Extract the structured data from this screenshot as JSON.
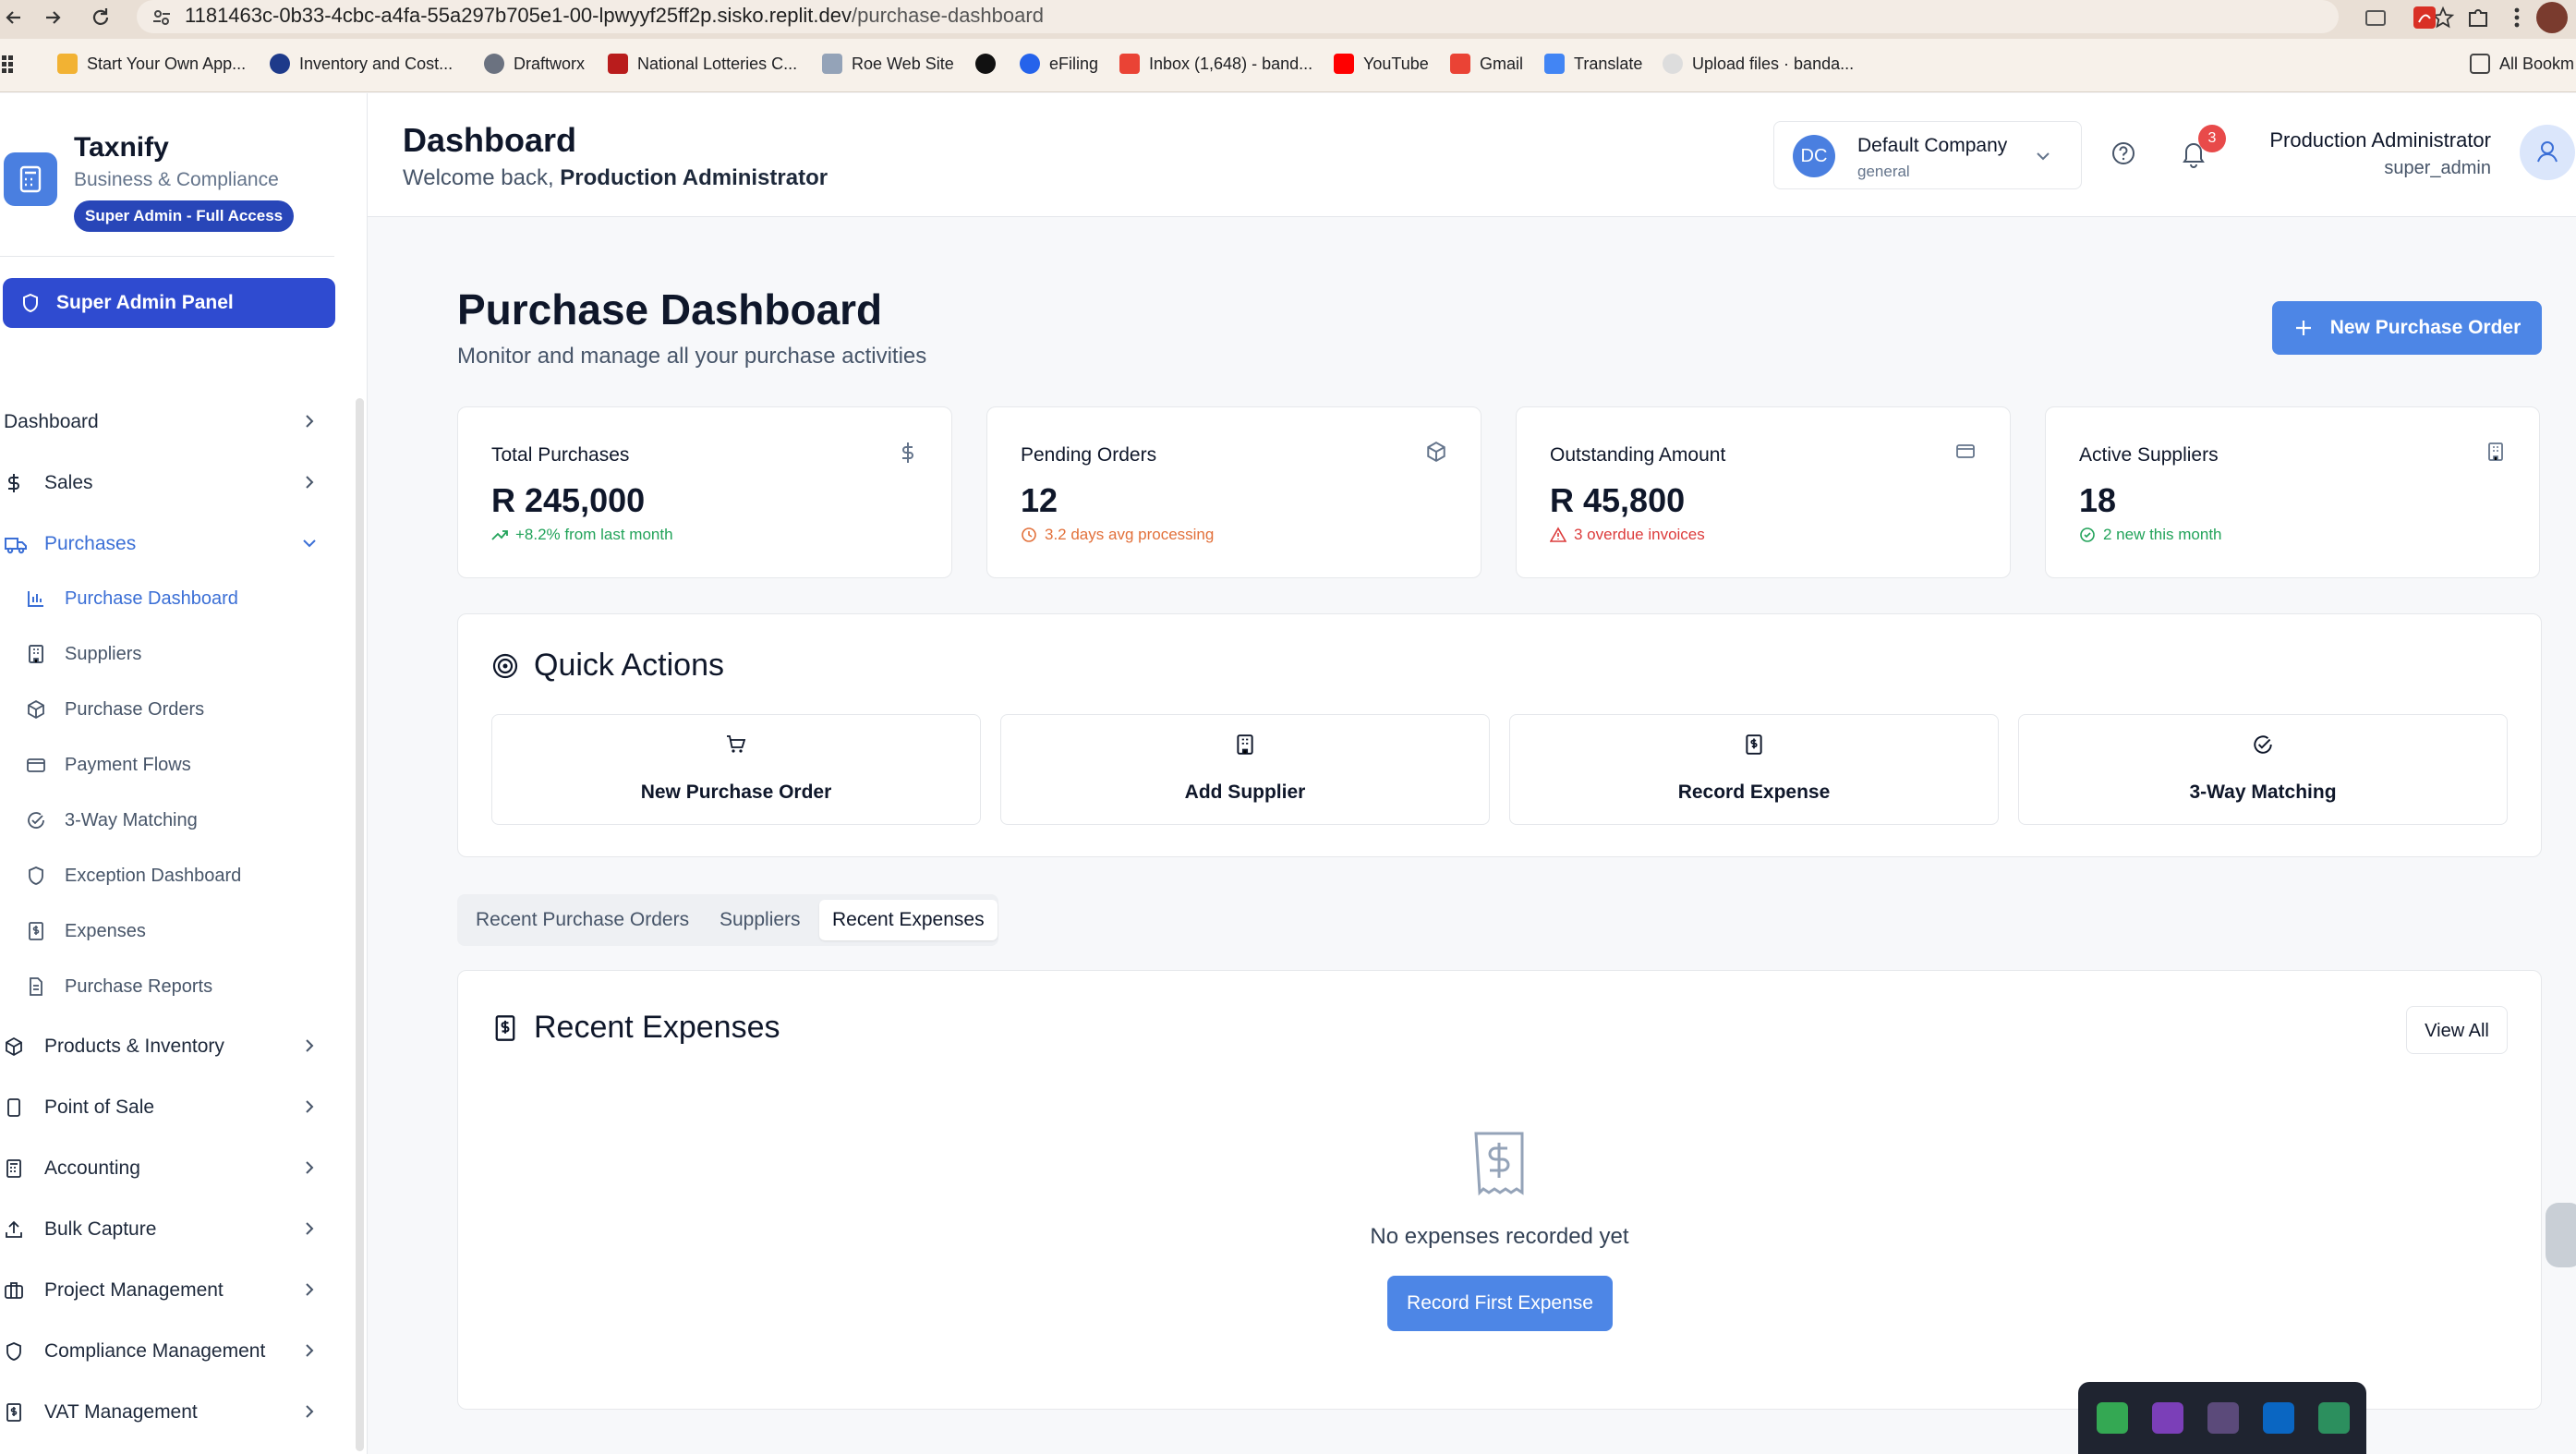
{
  "browser": {
    "url_host": "1181463c-0b33-4cbc-a4fa-55a297b705e1-00-lpwyyf25ff2p.sisko.replit.dev",
    "url_path": "/purchase-dashboard",
    "bookmarks": [
      "Start Your Own App...",
      "Inventory and Cost...",
      "Draftworx",
      "National Lotteries C...",
      "Roe Web Site",
      "",
      "eFiling",
      "Inbox (1,648) - band...",
      "YouTube",
      "Gmail",
      "Translate",
      "Upload files · banda...",
      "All Bookm"
    ]
  },
  "brand": {
    "name": "Taxnify",
    "subtitle": "Business & Compliance",
    "badge": "Super Admin - Full Access"
  },
  "sidebar": {
    "admin_panel": "Super Admin Panel",
    "items": [
      {
        "label": "Dashboard",
        "icon": "none"
      },
      {
        "label": "Sales",
        "icon": "dollar-icon"
      },
      {
        "label": "Purchases",
        "icon": "truck-icon"
      },
      {
        "label": "Products & Inventory",
        "icon": "package-icon"
      },
      {
        "label": "Point of Sale",
        "icon": "tablet-icon"
      },
      {
        "label": "Accounting",
        "icon": "calculator-icon"
      },
      {
        "label": "Bulk Capture",
        "icon": "upload-icon"
      },
      {
        "label": "Project Management",
        "icon": "briefcase-icon"
      },
      {
        "label": "Compliance Management",
        "icon": "shield-icon"
      },
      {
        "label": "VAT Management",
        "icon": "receipt-icon"
      }
    ],
    "purchases_sub": [
      {
        "label": "Purchase Dashboard",
        "icon": "bar-chart-icon"
      },
      {
        "label": "Suppliers",
        "icon": "building-icon"
      },
      {
        "label": "Purchase Orders",
        "icon": "package-icon"
      },
      {
        "label": "Payment Flows",
        "icon": "credit-card-icon"
      },
      {
        "label": "3-Way Matching",
        "icon": "check-circle-icon"
      },
      {
        "label": "Exception Dashboard",
        "icon": "shield-icon"
      },
      {
        "label": "Expenses",
        "icon": "receipt-icon"
      },
      {
        "label": "Purchase Reports",
        "icon": "file-text-icon"
      }
    ]
  },
  "header": {
    "title": "Dashboard",
    "welcome_prefix": "Welcome back,",
    "welcome_name": "Production Administrator",
    "company_initials": "DC",
    "company_name": "Default Company",
    "company_type": "general",
    "notification_count": "3",
    "user_name": "Production Administrator",
    "user_role": "super_admin"
  },
  "main": {
    "title": "Purchase Dashboard",
    "subtitle": "Monitor and manage all your purchase activities",
    "new_po_label": "New Purchase Order",
    "stats": [
      {
        "label": "Total Purchases",
        "value": "R 245,000",
        "note": "+8.2% from last month",
        "note_color": "#22a35a",
        "icon": "dollar-icon"
      },
      {
        "label": "Pending Orders",
        "value": "12",
        "note": "3.2 days avg processing",
        "note_color": "#e2703a",
        "icon": "package-icon"
      },
      {
        "label": "Outstanding Amount",
        "value": "R 45,800",
        "note": "3 overdue invoices",
        "note_color": "#dc3b3b",
        "icon": "credit-card-icon"
      },
      {
        "label": "Active Suppliers",
        "value": "18",
        "note": "2 new this month",
        "note_color": "#22a35a",
        "icon": "building-icon"
      }
    ],
    "quick_actions": {
      "title": "Quick Actions",
      "items": [
        {
          "label": "New Purchase Order",
          "icon": "cart-icon"
        },
        {
          "label": "Add Supplier",
          "icon": "building-icon"
        },
        {
          "label": "Record Expense",
          "icon": "receipt-icon"
        },
        {
          "label": "3-Way Matching",
          "icon": "check-circle-icon"
        }
      ]
    },
    "tabs": [
      "Recent Purchase Orders",
      "Suppliers",
      "Recent Expenses"
    ],
    "active_tab": "Recent Expenses",
    "recent_expenses": {
      "title": "Recent Expenses",
      "view_all": "View All",
      "empty_text": "No expenses recorded yet",
      "record_first": "Record First Expense"
    }
  },
  "colors": {
    "accent": "#4d86e6",
    "admin_panel": "#2f4bd0",
    "positive": "#22a35a",
    "warning": "#e2703a",
    "danger": "#dc3b3b"
  }
}
